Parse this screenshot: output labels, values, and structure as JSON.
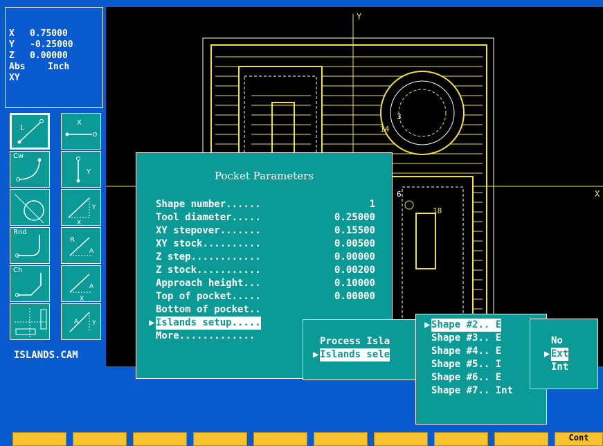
{
  "readout": {
    "x_label": "X",
    "x_value": "0.75000",
    "y_label": "Y",
    "y_value": "-0.25000",
    "z_label": "Z",
    "z_value": "0.00000",
    "mode": "Abs",
    "units": "Inch",
    "plane": "XY"
  },
  "palette": {
    "line_tag": "L",
    "cw_tag": "Cw",
    "rnd_tag": "Rnd",
    "ch_tag": "Ch",
    "x_tag": "X",
    "y_tag": "Y",
    "r_tag": "R",
    "a_tag": "A"
  },
  "filename": "ISLANDS.CAM",
  "canvas": {
    "y_axis_label": "Y",
    "x_axis_label": "X",
    "labels": [
      "3",
      "14",
      "6",
      "18"
    ]
  },
  "pocket": {
    "title": "Pocket Parameters",
    "items": [
      {
        "label": "Shape number......",
        "value": "1"
      },
      {
        "label": "Tool diameter.....",
        "value": "0.25000"
      },
      {
        "label": "XY stepover.......",
        "value": "0.15500"
      },
      {
        "label": "XY stock..........",
        "value": "0.00500"
      },
      {
        "label": "Z step............",
        "value": "0.00000"
      },
      {
        "label": "Z stock...........",
        "value": "0.00200"
      },
      {
        "label": "Approach height...",
        "value": "0.10000"
      },
      {
        "label": "Top of pocket.....",
        "value": "0.00000"
      },
      {
        "label": "Bottom of pocket..",
        "value": ""
      },
      {
        "label": "Islands setup.....",
        "value": ""
      },
      {
        "label": "More.............",
        "value": ""
      }
    ]
  },
  "islands": {
    "items": [
      "Process Isla",
      "Islands sele"
    ]
  },
  "shapes": {
    "items": [
      "Shape #2.. E",
      "Shape #3.. E",
      "Shape #4.. E",
      "Shape #5.. I",
      "Shape #6.. E",
      "Shape #7.. Int"
    ]
  },
  "ext": {
    "items": [
      "No",
      "Ext",
      "Int"
    ]
  },
  "fkeys": {
    "last_label": "Cont"
  },
  "colors": {
    "background": "#0a5ad0",
    "panel": "#0c9a96",
    "drawing": "#f2e23a",
    "fkey": "#f7c230"
  }
}
